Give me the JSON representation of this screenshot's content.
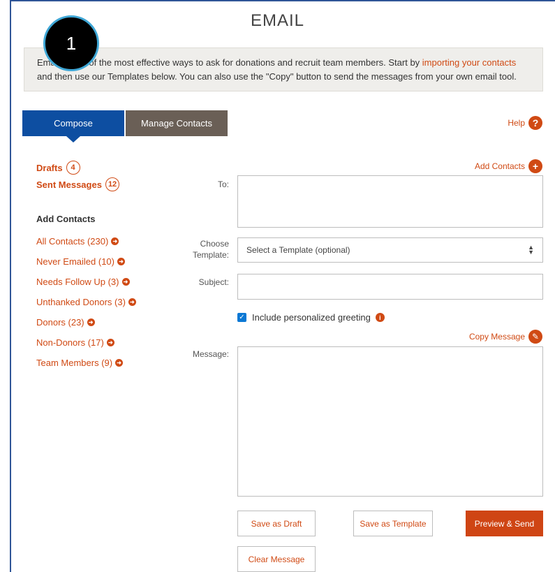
{
  "page": {
    "title": "EMAIL"
  },
  "step_badge": "1",
  "intro": {
    "text_before": "Email is one of the most effective ways to ask for donations and recruit team members. Start by ",
    "link": "importing your contacts",
    "text_after": " and then use our Templates below. You can also use the \"Copy\" button to send the messages from your own email tool."
  },
  "tabs": [
    {
      "label": "Compose",
      "active": true
    },
    {
      "label": "Manage Contacts",
      "active": false
    }
  ],
  "help": {
    "label": "Help",
    "icon": "question-icon"
  },
  "sidebar": {
    "drafts": {
      "label": "Drafts",
      "count": "4"
    },
    "sent": {
      "label": "Sent Messages",
      "count": "12"
    },
    "add_contacts_heading": "Add Contacts",
    "contacts": [
      "All Contacts (230)",
      "Never Emailed (10)",
      "Needs Follow Up (3)",
      "Unthanked Donors (3)",
      "Donors (23)",
      "Non-Donors (17)",
      "Team Members (9)"
    ]
  },
  "form": {
    "add_contacts_label": "Add Contacts",
    "to_label": "To:",
    "template_label_line1": "Choose",
    "template_label_line2": "Template:",
    "template_placeholder": "Select a Template (optional)",
    "subject_label": "Subject:",
    "greeting_label": "Include personalized greeting",
    "greeting_checked": true,
    "copy_message_label": "Copy Message",
    "message_label": "Message:",
    "to_value": "",
    "subject_value": "",
    "message_value": ""
  },
  "buttons": {
    "save_draft": "Save as Draft",
    "save_template": "Save as Template",
    "preview_send": "Preview & Send",
    "clear_message": "Clear Message"
  },
  "colors": {
    "accent": "#d04a14",
    "compose_tab": "#0d4ea1",
    "manage_tab": "#6a5f56",
    "checkbox": "#0a78d4"
  }
}
